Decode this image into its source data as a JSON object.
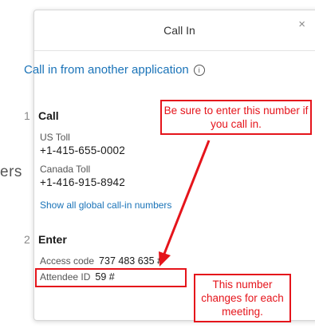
{
  "background_fragment": "ers",
  "dialog": {
    "title": "Call In",
    "close_glyph": "×",
    "app_link": "Call in from another application",
    "info_glyph": "i",
    "step1": {
      "number": "1",
      "label": "Call",
      "us_label": "US Toll",
      "us_number": "+1-415-655-0002",
      "canada_label": "Canada Toll",
      "canada_number": "+1-416-915-8942",
      "show_all": "Show all global call-in numbers"
    },
    "step2": {
      "number": "2",
      "label": "Enter",
      "access_label": "Access code",
      "access_value": "737 483 635 #",
      "attendee_label": "Attendee ID",
      "attendee_value": "59 #"
    }
  },
  "annotations": {
    "top_callout": "Be sure to enter this number if you call in.",
    "bottom_callout": "This number changes for each meeting.",
    "color": "#e5141b"
  },
  "icons": {
    "close": "close-icon",
    "info": "info-icon"
  }
}
